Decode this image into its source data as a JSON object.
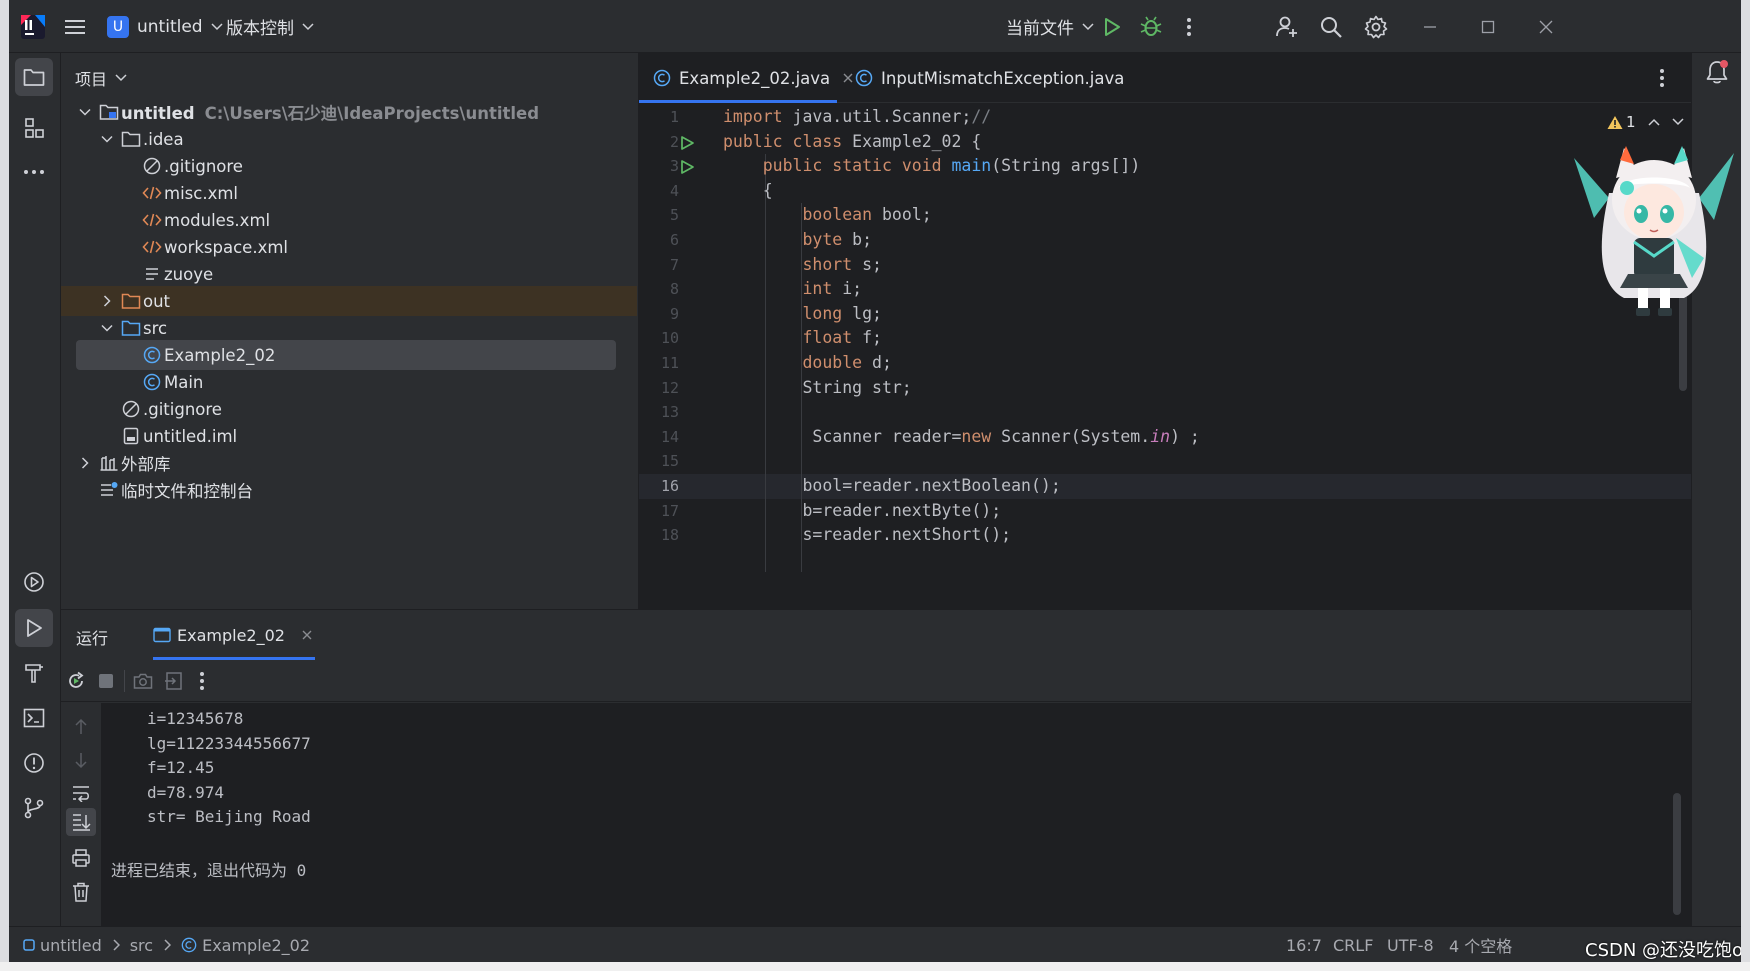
{
  "titlebar": {
    "project_badge": "U",
    "project_name": "untitled",
    "vcs_label": "版本控制",
    "run_config": "当前文件"
  },
  "project_panel": {
    "title": "项目",
    "tree": [
      {
        "label": "untitled",
        "path": "C:\\Users\\石少迪\\IdeaProjects\\untitled"
      },
      {
        "label": ".idea"
      },
      {
        "label": ".gitignore"
      },
      {
        "label": "misc.xml"
      },
      {
        "label": "modules.xml"
      },
      {
        "label": "workspace.xml"
      },
      {
        "label": "zuoye"
      },
      {
        "label": "out"
      },
      {
        "label": "src"
      },
      {
        "label": "Example2_02"
      },
      {
        "label": "Main"
      },
      {
        "label": ".gitignore"
      },
      {
        "label": "untitled.iml"
      },
      {
        "label": "外部库"
      },
      {
        "label": "临时文件和控制台"
      }
    ]
  },
  "editor": {
    "tabs": [
      {
        "label": "Example2_02.java",
        "active": true
      },
      {
        "label": "InputMismatchException.java",
        "active": false
      }
    ],
    "warning_count": "1",
    "current_line": 16,
    "line_numbers": [
      "1",
      "2",
      "3",
      "4",
      "5",
      "6",
      "7",
      "8",
      "9",
      "10",
      "11",
      "12",
      "13",
      "14",
      "15",
      "16",
      "17",
      "18"
    ],
    "code": [
      {
        "t": [
          [
            "kw",
            "import"
          ],
          [
            "",
            " java.util.Scanner;"
          ],
          [
            "cm",
            "//"
          ]
        ]
      },
      {
        "t": [
          [
            "kw",
            "public class"
          ],
          [
            "",
            " Example2_02 {"
          ]
        ]
      },
      {
        "t": [
          [
            "",
            "    "
          ],
          [
            "kw",
            "public static void"
          ],
          [
            "",
            " "
          ],
          [
            "fn",
            "main"
          ],
          [
            "",
            "(String args[])"
          ]
        ]
      },
      {
        "t": [
          [
            "",
            "    {"
          ]
        ]
      },
      {
        "t": [
          [
            "",
            "        "
          ],
          [
            "kw",
            "boolean"
          ],
          [
            "",
            " bool;"
          ]
        ]
      },
      {
        "t": [
          [
            "",
            "        "
          ],
          [
            "kw",
            "byte"
          ],
          [
            "",
            " b;"
          ]
        ]
      },
      {
        "t": [
          [
            "",
            "        "
          ],
          [
            "kw",
            "short"
          ],
          [
            "",
            " s;"
          ]
        ]
      },
      {
        "t": [
          [
            "",
            "        "
          ],
          [
            "kw",
            "int"
          ],
          [
            "",
            " i;"
          ]
        ]
      },
      {
        "t": [
          [
            "",
            "        "
          ],
          [
            "kw",
            "long"
          ],
          [
            "",
            " lg;"
          ]
        ]
      },
      {
        "t": [
          [
            "",
            "        "
          ],
          [
            "kw",
            "float"
          ],
          [
            "",
            " f;"
          ]
        ]
      },
      {
        "t": [
          [
            "",
            "        "
          ],
          [
            "kw",
            "double"
          ],
          [
            "",
            " d;"
          ]
        ]
      },
      {
        "t": [
          [
            "",
            "        String str;"
          ]
        ]
      },
      {
        "t": [
          [
            "",
            ""
          ]
        ]
      },
      {
        "t": [
          [
            "",
            "         Scanner reader="
          ],
          [
            "kw",
            "new"
          ],
          [
            "",
            " Scanner(System."
          ],
          [
            "st",
            "in"
          ],
          [
            "",
            ") ;"
          ]
        ]
      },
      {
        "t": [
          [
            "",
            ""
          ]
        ]
      },
      {
        "t": [
          [
            "",
            "        bool=reader.nextBoolean();"
          ]
        ]
      },
      {
        "t": [
          [
            "",
            "        b=reader.nextByte();"
          ]
        ]
      },
      {
        "t": [
          [
            "",
            "        s=reader.nextShort();"
          ]
        ]
      }
    ]
  },
  "run_panel": {
    "title": "运行",
    "tab_label": "Example2_02",
    "output": [
      "i=12345678",
      "lg=11223344556677",
      "f=12.45",
      "d=78.974",
      "str= Beijing Road",
      "",
      "进程已结束，退出代码为 0"
    ]
  },
  "statusbar": {
    "breadcrumb": [
      "untitled",
      "src",
      "Example2_02"
    ],
    "position": "16:7",
    "line_sep": "CRLF",
    "encoding": "UTF-8",
    "indent": "4 个空格"
  },
  "watermark": "CSDN @还没吃饱o",
  "colors": {
    "background": "#1e1f22",
    "panel": "#2b2d30",
    "accent": "#3574f0",
    "keyword": "#cf8e6d",
    "function": "#56a8f5",
    "run_green": "#5fb865"
  }
}
